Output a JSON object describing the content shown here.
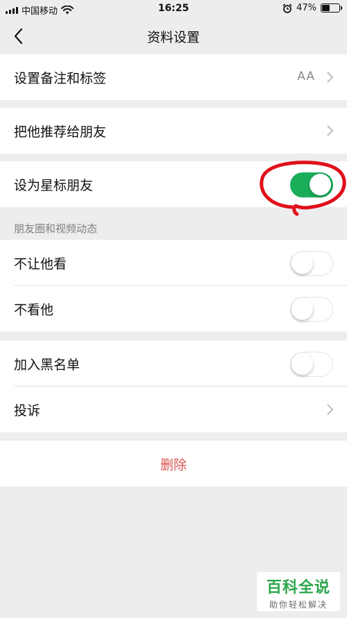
{
  "status_bar": {
    "carrier": "中国移动",
    "time": "16:25",
    "battery": "47%",
    "battery_level": 0.47
  },
  "nav": {
    "title": "资料设置",
    "back_icon": "chevron-left-icon"
  },
  "rows": {
    "remark": {
      "label": "设置备注和标签",
      "value": "AA"
    },
    "recommend": {
      "label": "把他推荐给朋友"
    },
    "star": {
      "label": "设为星标朋友",
      "enabled": true
    },
    "no_see_me": {
      "label": "不让他看",
      "enabled": false
    },
    "no_see_him": {
      "label": "不看他",
      "enabled": false
    },
    "blacklist": {
      "label": "加入黑名单",
      "enabled": false
    },
    "complain": {
      "label": "投诉"
    },
    "delete": {
      "label": "删除"
    }
  },
  "section": {
    "moments_header": "朋友圈和视频动态"
  },
  "watermark": {
    "title": "百科全说",
    "subtitle": "助你轻松解决"
  },
  "colors": {
    "toggle_on": "#1aad5a",
    "delete": "#d9534f",
    "annotation": "#e0101a",
    "watermark_green": "#2aa64c"
  }
}
